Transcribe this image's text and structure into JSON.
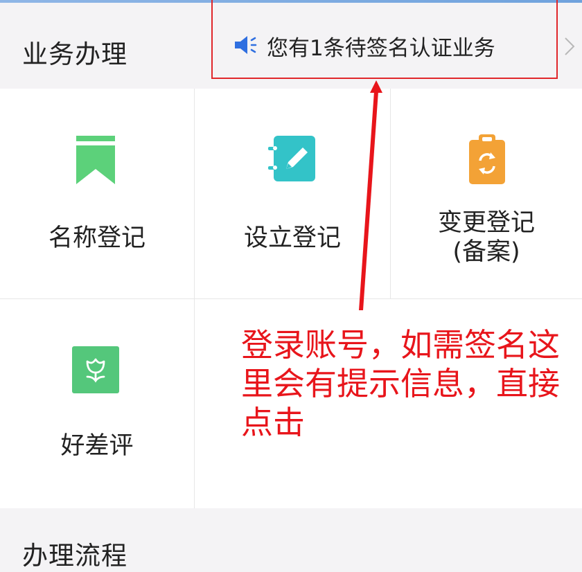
{
  "header": {
    "title": "业务办理"
  },
  "notice": {
    "text": "您有1条待签名认证业务",
    "icon": "speaker-icon",
    "icon_color": "#2f6fe0"
  },
  "services": [
    {
      "label": "名称登记",
      "icon": "bookmark-icon",
      "color": "#5cd17a"
    },
    {
      "label": "设立登记",
      "icon": "notebook-pen-icon",
      "color": "#33c3c8"
    },
    {
      "label_line1": "变更登记",
      "label_line2": "(备案)",
      "icon": "clipboard-refresh-icon",
      "color": "#f3a236"
    },
    {
      "label": "好差评",
      "icon": "flower-icon",
      "color": "#54c77b"
    }
  ],
  "bottom": {
    "title": "办理流程"
  },
  "annotation": {
    "text": "登录账号，如需签名这里会有提示信息，直接点击",
    "color": "#e8151b"
  }
}
